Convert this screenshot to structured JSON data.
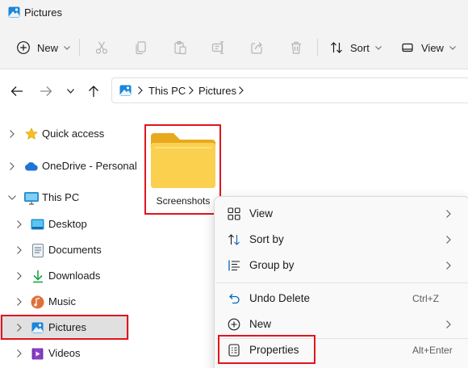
{
  "window": {
    "title": "Pictures",
    "icon": "pictures-app-icon"
  },
  "toolbar": {
    "new_label": "New",
    "sort_label": "Sort",
    "view_label": "View",
    "icons": [
      "plus-circle-icon",
      "cut-icon",
      "copy-icon",
      "paste-icon",
      "rename-icon",
      "share-icon",
      "delete-icon",
      "sort-icon",
      "view-icon"
    ]
  },
  "address": {
    "crumbs": [
      "This PC",
      "Pictures"
    ],
    "location_icon": "pictures-icon"
  },
  "sidebar": {
    "items": [
      {
        "label": "Quick access",
        "icon": "star-icon"
      },
      {
        "label": "OneDrive - Personal",
        "icon": "cloud-icon"
      },
      {
        "label": "This PC",
        "icon": "monitor-icon",
        "expanded": true
      },
      {
        "label": "Desktop",
        "icon": "desktop-icon"
      },
      {
        "label": "Documents",
        "icon": "documents-icon"
      },
      {
        "label": "Downloads",
        "icon": "downloads-icon"
      },
      {
        "label": "Music",
        "icon": "music-icon"
      },
      {
        "label": "Pictures",
        "icon": "pictures-icon",
        "selected": true
      },
      {
        "label": "Videos",
        "icon": "videos-icon"
      }
    ]
  },
  "content": {
    "folders": [
      {
        "name": "Screenshots",
        "icon": "folder-icon"
      }
    ]
  },
  "context_menu": {
    "items": [
      {
        "label": "View",
        "icon": "view-grid-icon",
        "submenu": true
      },
      {
        "label": "Sort by",
        "icon": "sort-icon",
        "submenu": true
      },
      {
        "label": "Group by",
        "icon": "group-by-icon",
        "submenu": true
      },
      {
        "label": "Undo Delete",
        "icon": "undo-icon",
        "shortcut": "Ctrl+Z"
      },
      {
        "label": "New",
        "icon": "plus-circle-icon",
        "submenu": true
      },
      {
        "label": "Properties",
        "icon": "properties-icon",
        "shortcut": "Alt+Enter"
      }
    ]
  },
  "colors": {
    "highlight": "#e0151f",
    "folder": "#f7c948",
    "accent": "#0067c0",
    "chrome": "#f3f3f3"
  }
}
